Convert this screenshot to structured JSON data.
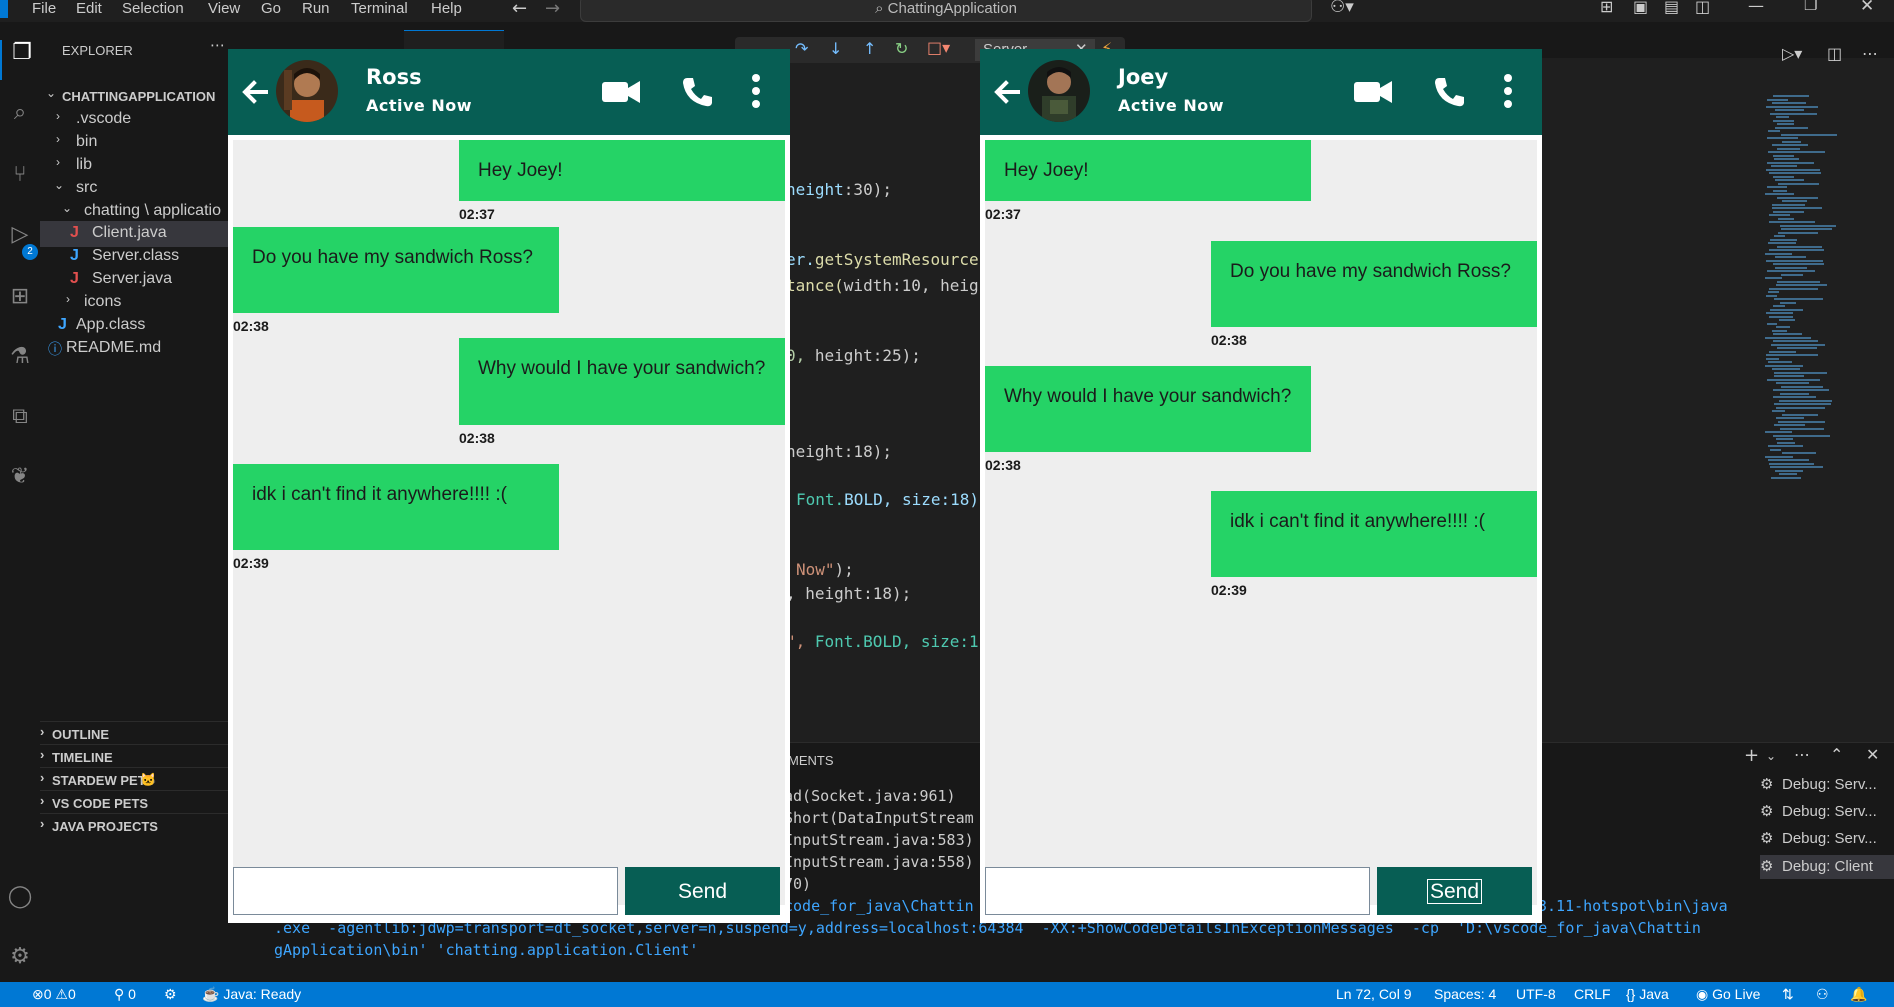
{
  "titlebar": {
    "menu": [
      "File",
      "Edit",
      "Selection",
      "View",
      "Go",
      "Run",
      "Terminal",
      "Help"
    ],
    "search": "ChattingApplication"
  },
  "debug_toolbar": {
    "config": "Server"
  },
  "sidebar": {
    "title": "EXPLORER",
    "project": "CHATTINGAPPLICATION",
    "items": [
      {
        "label": ".vscode"
      },
      {
        "label": "bin"
      },
      {
        "label": "lib"
      },
      {
        "label": "src"
      },
      {
        "label": "chatting \\ applicatio"
      },
      {
        "label": "Client.java"
      },
      {
        "label": "Server.class"
      },
      {
        "label": "Server.java"
      },
      {
        "label": "icons"
      },
      {
        "label": "App.class"
      },
      {
        "label": "README.md"
      }
    ],
    "run_badge": "2",
    "panels": [
      "OUTLINE",
      "TIMELINE",
      "STARDEW PETS",
      "VS CODE PETS",
      "JAVA PROJECTS"
    ]
  },
  "editor": {
    "lines": [
      {
        "a": "height",
        "b": ":30);"
      },
      {
        "a": "er.",
        "b": "getSystemResource"
      },
      {
        "a": "tance(",
        "b": "width:10, heig"
      },
      {
        "a": "0, ",
        "b": "height:25);"
      },
      {
        "a": "height",
        "b": ":18);"
      },
      {
        "a": "Font.",
        "b": "BOLD, size:18)"
      },
      {
        "a": "Now\"",
        "b": ");"
      },
      {
        "a": ", ",
        "b": "height:18);"
      },
      {
        "a": "\", ",
        "b": "Font.BOLD, size:1"
      }
    ]
  },
  "terminal": {
    "tab_label": "MENTS",
    "lines": [
      "ad(Socket.java:961)",
      "Short(DataInputStream",
      "InputStream.java:583)",
      "InputStream.java:558)",
      "70)"
    ],
    "cmd_line1_left": "code_for_java\\Chattin",
    "cmd_line1_right": "3.11-hotspot\\bin\\java",
    "cmd_line2": ".exe  -agentlib:jdwp=transport=dt_socket,server=n,suspend=y,address=localhost:64384  -XX:+ShowCodeDetailsInExceptionMessages  -cp  'D:\\vscode_for_java\\Chattin",
    "cmd_line3": "gApplication\\bin' 'chatting.application.Client'",
    "debug_sessions": [
      "Debug: Serv...",
      "Debug: Serv...",
      "Debug: Serv...",
      "Debug: Client"
    ]
  },
  "statusbar": {
    "errors": "0",
    "warnings": "0",
    "ports": "0",
    "java": "Java: Ready",
    "position": "Ln 72, Col 9",
    "spaces": "Spaces: 4",
    "encoding": "UTF-8",
    "eol": "CRLF",
    "lang": "Java",
    "golive": "Go Live"
  },
  "chats": [
    {
      "name": "Ross",
      "status": "Active Now",
      "send_label": "Send",
      "messages": [
        {
          "text": "Hey Joey!",
          "time": "02:37",
          "side": "right"
        },
        {
          "text": "Do you have my sandwich Ross?",
          "time": "02:38",
          "side": "left"
        },
        {
          "text": "Why would I have your sandwich?",
          "time": "02:38",
          "side": "right"
        },
        {
          "text": "idk i can't find it anywhere!!!! :(",
          "time": "02:39",
          "side": "left"
        }
      ]
    },
    {
      "name": "Joey",
      "status": "Active Now",
      "send_label": "Send",
      "messages": [
        {
          "text": "Hey Joey!",
          "time": "02:37",
          "side": "left"
        },
        {
          "text": "Do you have my sandwich Ross?",
          "time": "02:38",
          "side": "right"
        },
        {
          "text": "Why would I have your sandwich?",
          "time": "02:38",
          "side": "left"
        },
        {
          "text": "idk i can't find it anywhere!!!! :(",
          "time": "02:39",
          "side": "right"
        }
      ]
    }
  ],
  "colors": {
    "header": "#075e54",
    "bubble": "#25d366",
    "statusbar": "#0078d4"
  }
}
